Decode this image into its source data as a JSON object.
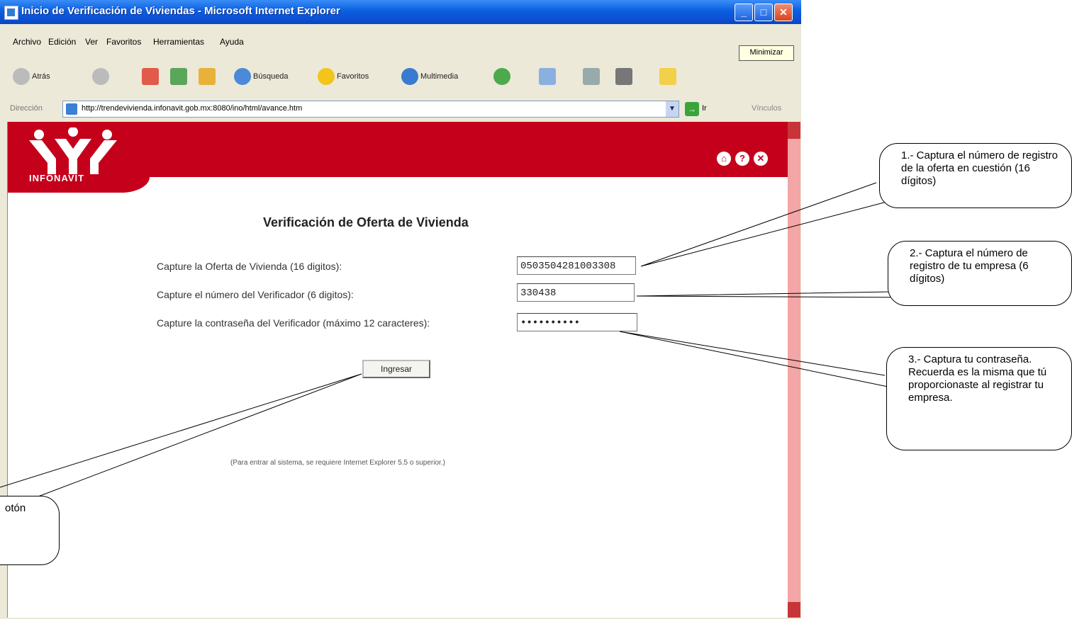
{
  "window": {
    "title": "Inicio de Verificación de Viviendas - Microsoft Internet Explorer",
    "controls": {
      "minimize": "_",
      "maximize": "□",
      "close": "✕"
    }
  },
  "menu": [
    "Archivo",
    "Edición",
    "Ver",
    "Favoritos",
    "Herramientas",
    "Ayuda"
  ],
  "minimize_tip": "Minimizar",
  "toolbar": {
    "back": "Atrás",
    "search": "Búsqueda",
    "favorites": "Favoritos",
    "multimedia": "Multimedia"
  },
  "address": {
    "label": "Dirección",
    "url": "http://trendevivienda.infonavit.gob.mx:8080/ino/html/avance.htm",
    "go": "Ir",
    "links": "Vínculos"
  },
  "brand": {
    "name": "INFONAVIT",
    "color": "#c4001b"
  },
  "form": {
    "title": "Verificación de Oferta de Vivienda",
    "fields": [
      {
        "label": "Capture la Oferta de Vivienda (16 digitos):",
        "value": "0503504281003308"
      },
      {
        "label": "Capture el número del Verificador (6 digitos):",
        "value": "330438"
      },
      {
        "label": "Capture la contraseña del Verificador (máximo 12 caracteres):",
        "value": "••••••••••"
      }
    ],
    "submit": "Ingresar",
    "note": "(Para entrar al sistema, se requiere Internet Explorer 5.5 o superior.)"
  },
  "callouts": [
    {
      "text": "1.- Captura el número de registro de la oferta en cuestión (16 dígitos)"
    },
    {
      "text": "2.- Captura el número de registro de tu empresa (6 dígitos)"
    },
    {
      "text": "3.- Captura tu contraseña. Recuerda es la misma que tú proporcionaste al registrar tu empresa."
    },
    {
      "text": "otón"
    }
  ]
}
